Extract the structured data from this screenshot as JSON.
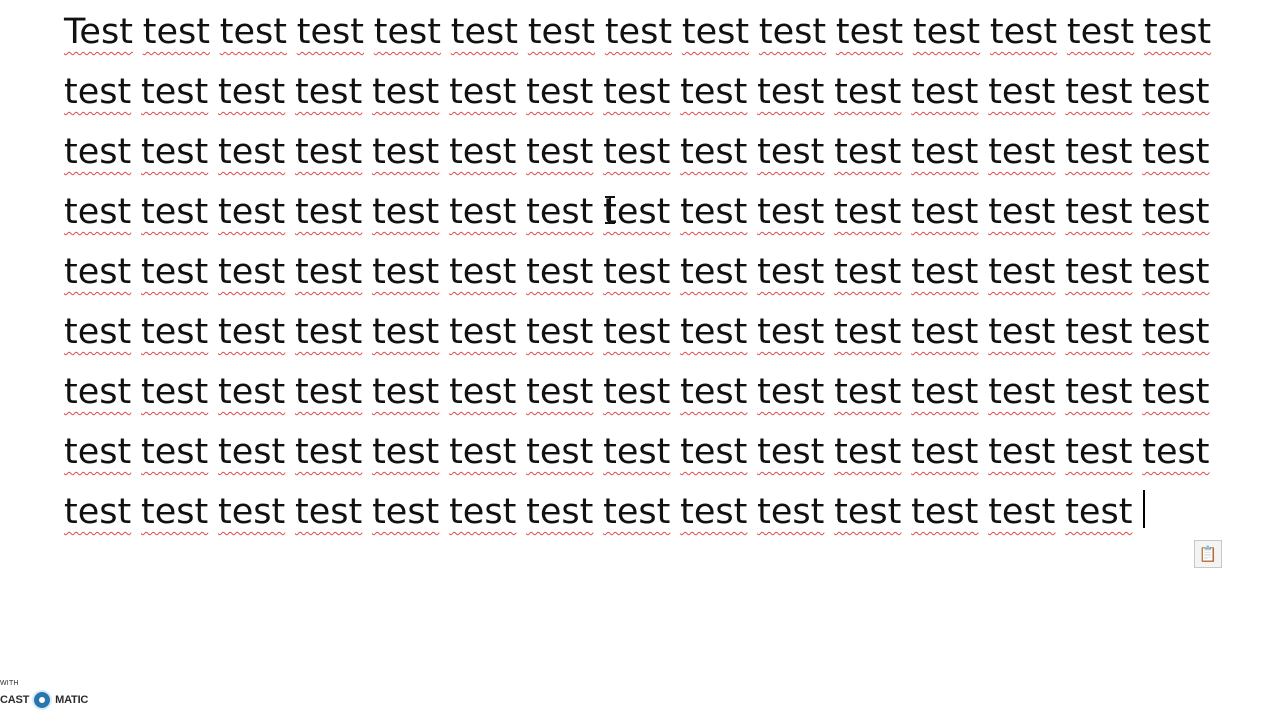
{
  "document": {
    "lines": [
      [
        "Test",
        "test",
        "test",
        "test",
        "test",
        "test",
        "test",
        "test",
        "test",
        "test",
        "test",
        "test",
        "test",
        "test",
        "test"
      ],
      [
        "test",
        "test",
        "test",
        "test",
        "test",
        "test",
        "test",
        "test",
        "test",
        "test",
        "test",
        "test",
        "test",
        "test",
        "test"
      ],
      [
        "test",
        "test",
        "test",
        "test",
        "test",
        "test",
        "test",
        "test",
        "test",
        "test",
        "test",
        "test",
        "test",
        "test",
        "test"
      ],
      [
        "test",
        "test",
        "test",
        "test",
        "test",
        "test",
        "test",
        "test",
        "test",
        "test",
        "test",
        "test",
        "test",
        "test",
        "test"
      ],
      [
        "test",
        "test",
        "test",
        "test",
        "test",
        "test",
        "test",
        "test",
        "test",
        "test",
        "test",
        "test",
        "test",
        "test",
        "test"
      ],
      [
        "test",
        "test",
        "test",
        "test",
        "test",
        "test",
        "test",
        "test",
        "test",
        "test",
        "test",
        "test",
        "test",
        "test",
        "test"
      ],
      [
        "test",
        "test",
        "test",
        "test",
        "test",
        "test",
        "test",
        "test",
        "test",
        "test",
        "test",
        "test",
        "test",
        "test",
        "test"
      ],
      [
        "test",
        "test",
        "test",
        "test",
        "test",
        "test",
        "test",
        "test",
        "test",
        "test",
        "test",
        "test",
        "test",
        "test",
        "test"
      ],
      [
        "test",
        "test",
        "test",
        "test",
        "test",
        "test",
        "test",
        "test",
        "test",
        "test",
        "test",
        "test",
        "test",
        "test"
      ]
    ],
    "spellcheck_color": "#e04a4a",
    "text_color": "#111111"
  },
  "overlay": {
    "paste_options_icon": "clipboard-icon",
    "paste_options_glyph": "📋",
    "cursor_icon": "i-beam-cursor-icon"
  },
  "watermark": {
    "small_text": "WITH",
    "brand_left": "CAST",
    "brand_right": "MATIC",
    "icon": "record-icon",
    "accent_color": "#1f6fa8"
  }
}
